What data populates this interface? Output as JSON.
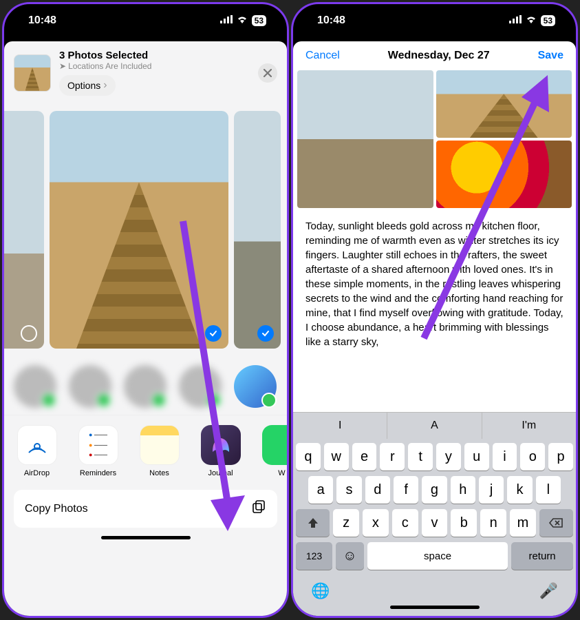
{
  "status": {
    "time": "10:48",
    "battery": "53"
  },
  "share": {
    "title": "3 Photos Selected",
    "subtitle": "Locations Are Included",
    "options": "Options",
    "apps": {
      "airdrop": "AirDrop",
      "reminders": "Reminders",
      "notes": "Notes",
      "journal": "Journal",
      "whatsapp": "W"
    },
    "copy": "Copy Photos"
  },
  "journal": {
    "cancel": "Cancel",
    "title": "Wednesday, Dec 27",
    "save": "Save",
    "body": "Today, sunlight bleeds gold across my kitchen floor, reminding me of warmth even as winter stretches its icy fingers. Laughter still echoes in the rafters, the sweet aftertaste of a shared afternoon with loved ones. It's in these simple moments, in the rustling leaves whispering secrets to the wind and the comforting hand reaching for mine, that I find myself overflowing with gratitude. Today, I choose abundance, a heart brimming with blessings like a starry sky,",
    "suggestions": {
      "s1": "I",
      "s2": "A",
      "s3": "I'm"
    }
  },
  "keyboard": {
    "row1": [
      "q",
      "w",
      "e",
      "r",
      "t",
      "y",
      "u",
      "i",
      "o",
      "p"
    ],
    "row2": [
      "a",
      "s",
      "d",
      "f",
      "g",
      "h",
      "j",
      "k",
      "l"
    ],
    "row3": [
      "z",
      "x",
      "c",
      "v",
      "b",
      "n",
      "m"
    ],
    "num": "123",
    "space": "space",
    "ret": "return"
  }
}
